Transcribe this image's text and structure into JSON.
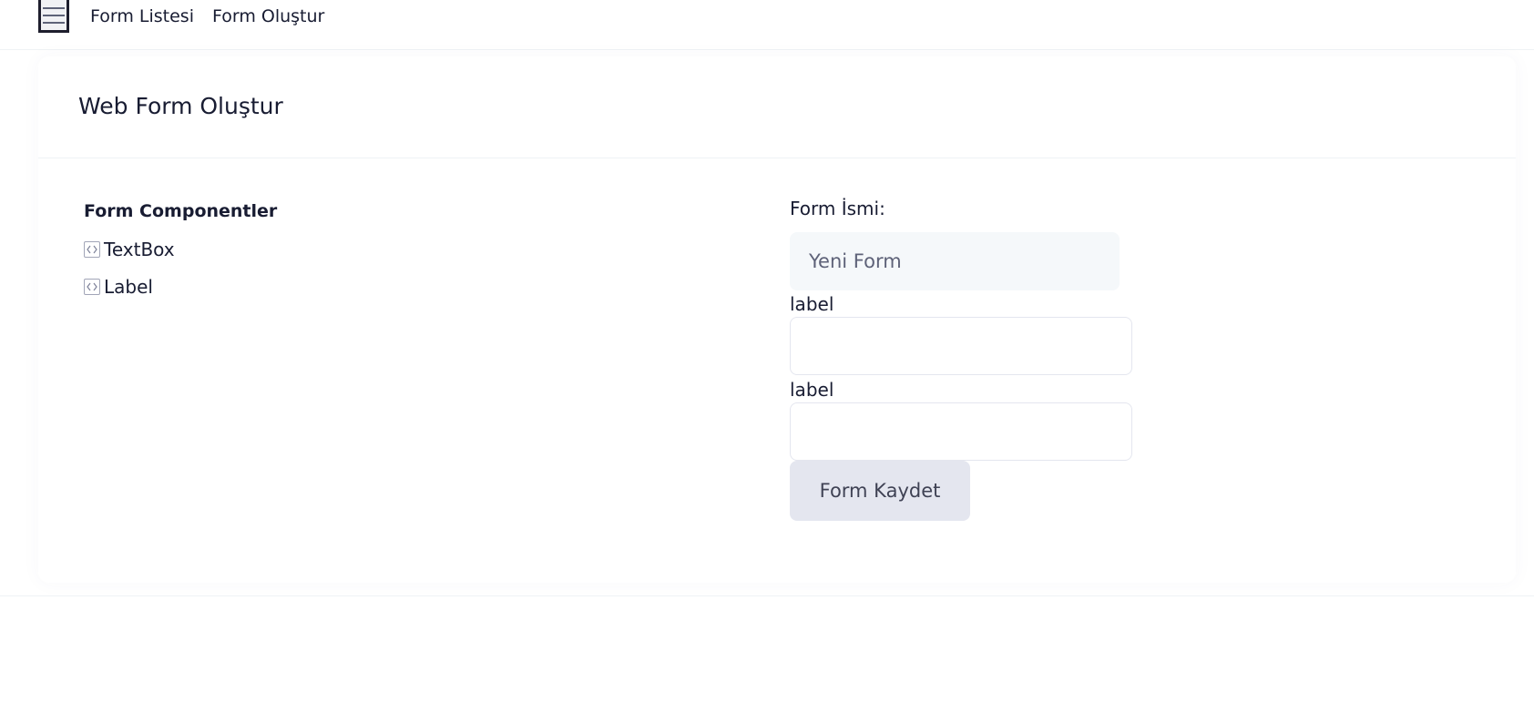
{
  "nav": {
    "menu_icon": "hamburger-menu-icon",
    "items": [
      {
        "label": "Form Listesi"
      },
      {
        "label": "Form Oluştur"
      }
    ]
  },
  "page": {
    "title": "Web Form Oluştur"
  },
  "components": {
    "title": "Form Componentler",
    "icon": "code-brackets-icon",
    "items": [
      {
        "label": "TextBox"
      },
      {
        "label": "Label"
      }
    ]
  },
  "form": {
    "name_label": "Form İsmi:",
    "name_value": "Yeni Form",
    "fields": [
      {
        "label": "label",
        "value": ""
      },
      {
        "label": "label",
        "value": ""
      }
    ],
    "save_label": "Form Kaydet"
  },
  "colors": {
    "text": "#181c32",
    "input_bg": "#f5f8fa",
    "button_bg": "#e4e6ef",
    "border": "#eff2f5"
  }
}
